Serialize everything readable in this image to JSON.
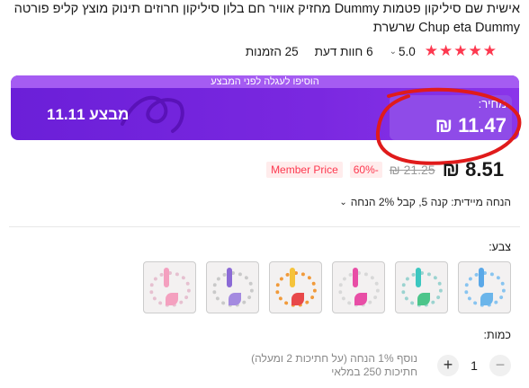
{
  "product": {
    "title": "אישית שם סיליקון פטמות Dummy מחזיק אוויר חם בלון סיליקון חרוזים תינוק מוצץ קליפ פורטה Chup eta Dummy שרשרת"
  },
  "rating": {
    "score": "5.0",
    "reviews": "6 חוות דעת",
    "orders": "25 הזמנות",
    "star_color": "#fd384f"
  },
  "promo": {
    "top_text": "הוסיפו לעגלה לפני המבצע",
    "price_label": "מחיר:",
    "price": "11.47 ₪",
    "sale_label": "מבצע 11.11",
    "bg_color": "#7a28e0"
  },
  "pricing": {
    "final_price": "8.51 ₪",
    "old_price": "21.25 ₪",
    "discount": "-60%",
    "member_badge": "Member Price",
    "accent_color": "#fd384f"
  },
  "instant_discount": {
    "text": "הנחה מיידית: קנה 5, קבל 2% הנחה"
  },
  "color_section": {
    "label": "צבע:",
    "swatches": [
      {
        "name": "blue-white",
        "clip": "#5aa8e8",
        "ring": "#88c4f0",
        "leaf": "#6bb5ea"
      },
      {
        "name": "teal-green",
        "clip": "#3cc7c0",
        "ring": "#9bd3d0",
        "leaf": "#4cc58a"
      },
      {
        "name": "pink-magenta",
        "clip": "#e84ea6",
        "ring": "#d8d8d8",
        "leaf": "#e84ea6"
      },
      {
        "name": "yellow-red",
        "clip": "#f5c33b",
        "ring": "#f19a3a",
        "leaf": "#e8484a"
      },
      {
        "name": "purple-grey",
        "clip": "#8b6ad6",
        "ring": "#c9c9c9",
        "leaf": "#a48ae0"
      },
      {
        "name": "light-pink",
        "clip": "#f4a0bf",
        "ring": "#e6c0d0",
        "leaf": "#f4a0bf"
      }
    ]
  },
  "quantity": {
    "label": "כמות:",
    "minus": "−",
    "plus": "+",
    "value": "1",
    "note_line1": "נוסף 1% הנחה (על חתיכות 2 ומעלה)",
    "note_line2": "חתיכות 250 במלאי"
  }
}
